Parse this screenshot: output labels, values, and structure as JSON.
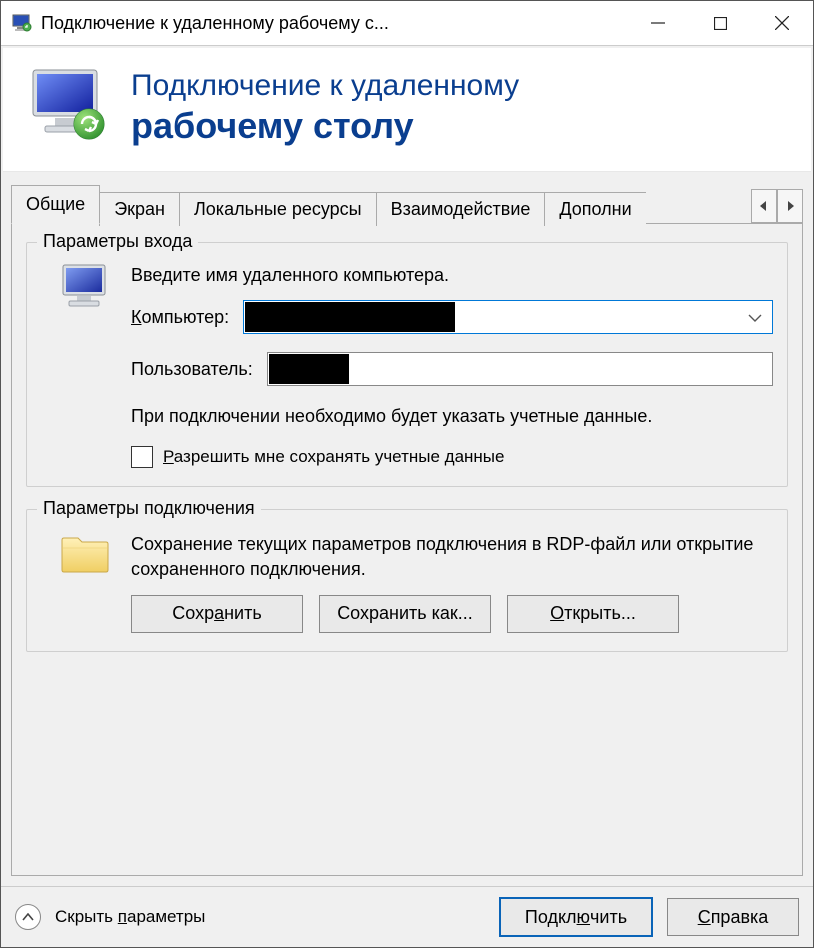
{
  "titlebar": {
    "title": "Подключение к удаленному рабочему с..."
  },
  "banner": {
    "line1": "Подключение к удаленному",
    "line2": "рабочему столу"
  },
  "tabs": {
    "items": [
      {
        "label": "Общие"
      },
      {
        "label": "Экран"
      },
      {
        "label": "Локальные ресурсы"
      },
      {
        "label": "Взаимодействие"
      },
      {
        "label": "Дополни"
      }
    ]
  },
  "login": {
    "legend": "Параметры входа",
    "instruction": "Введите имя удаленного компьютера.",
    "computer_label": "Компьютер:",
    "user_label": "Пользователь:",
    "note": "При подключении необходимо будет указать учетные данные.",
    "save_creds_label": "Разрешить мне сохранять учетные данные"
  },
  "connection": {
    "legend": "Параметры подключения",
    "desc": "Сохранение текущих параметров подключения в RDP-файл или открытие сохраненного подключения.",
    "save": "Сохранить",
    "save_as": "Сохранить как...",
    "open": "Открыть..."
  },
  "footer": {
    "hide_options": "Скрыть параметры",
    "connect": "Подключить",
    "help": "Справка"
  }
}
